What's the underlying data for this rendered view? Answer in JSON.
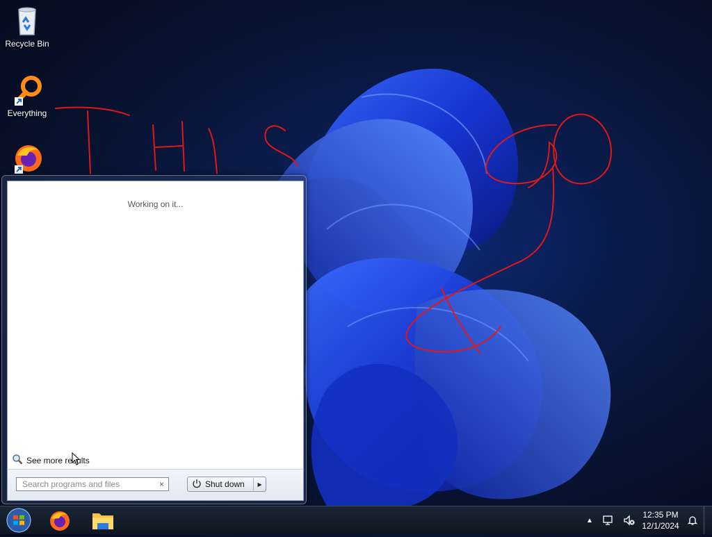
{
  "desktop": {
    "icons": [
      {
        "label": "Recycle Bin",
        "icon": "recycle-bin-icon"
      },
      {
        "label": "Everything",
        "icon": "everything-search-icon"
      },
      {
        "label": "",
        "icon": "firefox-icon"
      }
    ],
    "annotation_text": "THIS GO"
  },
  "start_menu": {
    "status_text": "Working on it...",
    "see_more_label": "See more results",
    "search": {
      "placeholder": "Search programs and files",
      "value": ""
    },
    "clear_glyph": "×",
    "shutdown_label": "Shut down"
  },
  "taskbar": {
    "apps": [
      "start-orb-icon",
      "firefox-icon",
      "file-explorer-icon"
    ],
    "clock": {
      "time": "12:35 PM",
      "date": "12/1/2024"
    },
    "tray_icons": [
      "show-hidden-icons-chevron",
      "network-icon",
      "volume-muted-icon",
      "notification-bell-icon"
    ]
  },
  "colors": {
    "annotation_red": "#e01818",
    "wallpaper_blue": "#1a3ee0"
  }
}
